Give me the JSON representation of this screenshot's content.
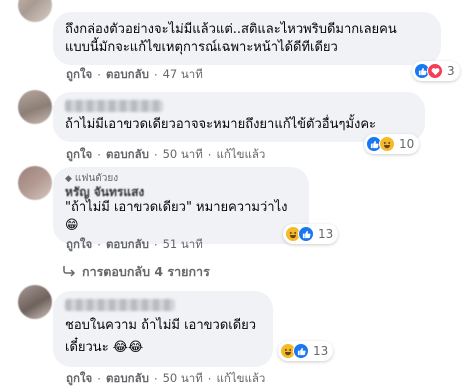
{
  "comments": [
    {
      "text_lines": [
        "ถึงกล่องตัวอย่างจะไม่มีแล้วแต่..สติและไหวพริบดีมากเลยคน",
        "แบบนี้มักจะแก้ไขเหตุการณ์เฉพาะหน้าได้ดีทีเดียว"
      ],
      "like_label": "ถูกใจ",
      "reply_label": "ตอบกลับ",
      "time": "47 นาที",
      "reactions": [
        "like",
        "love"
      ],
      "reaction_count": "3"
    },
    {
      "text": "ถ้าไม่มีเอาขวดเดียวอาจจะหมายถึงยาแก้ไข้ตัวอื่นๆมั้งคะ",
      "like_label": "ถูกใจ",
      "reply_label": "ตอบกลับ",
      "time": "50 นาที",
      "edited": "แก้ไขแล้ว",
      "reactions": [
        "like",
        "haha"
      ],
      "reaction_count": "10"
    },
    {
      "badge": "แฟนตัวยง",
      "author": "หรัญ จันทรแสง",
      "text": "\"ถ้าไม่มี เอาขวดเดียว\" หมายความว่าไง 😁",
      "like_label": "ถูกใจ",
      "reply_label": "ตอบกลับ",
      "time": "51 นาที",
      "reactions": [
        "haha",
        "like"
      ],
      "reaction_count": "13"
    },
    {
      "text_lines": [
        "ชอบในความ ถ้าไม่มี เอาขวดเดียว",
        "เดี๋ยวนะ 😂😂"
      ],
      "like_label": "ถูกใจ",
      "reply_label": "ตอบกลับ",
      "time": "50 นาที",
      "edited": "แก้ไขแล้ว",
      "reactions": [
        "haha",
        "like"
      ],
      "reaction_count": "13"
    }
  ],
  "replies_link": "การตอบกลับ 4 รายการ",
  "separator": "·"
}
